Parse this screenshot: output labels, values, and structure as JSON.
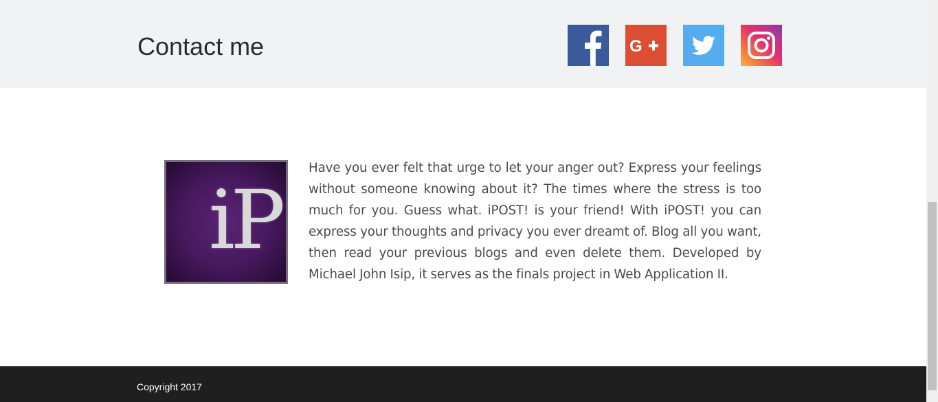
{
  "contact": {
    "title": "Contact me",
    "social": [
      {
        "name": "Facebook",
        "icon": "facebook-icon",
        "color": "#3a5a9b"
      },
      {
        "name": "Google+",
        "icon": "google-plus-icon",
        "color": "#dc4e33"
      },
      {
        "name": "Twitter",
        "icon": "twitter-icon",
        "color": "#55acee"
      },
      {
        "name": "Instagram",
        "icon": "instagram-icon",
        "color": "#c13584"
      }
    ]
  },
  "about": {
    "logo_text": "iP",
    "description": "Have you ever felt that urge to let your anger out? Express your feelings without someone knowing about it? The times where the stress is too much for you. Guess what. iPOST! is your friend! With iPOST! you can express your thoughts and privacy you ever dreamt of. Blog all you want, then read your previous blogs and even delete them. Developed by Michael John Isip, it serves as the finals project in Web Application II."
  },
  "footer": {
    "copyright": "Copyright 2017"
  }
}
